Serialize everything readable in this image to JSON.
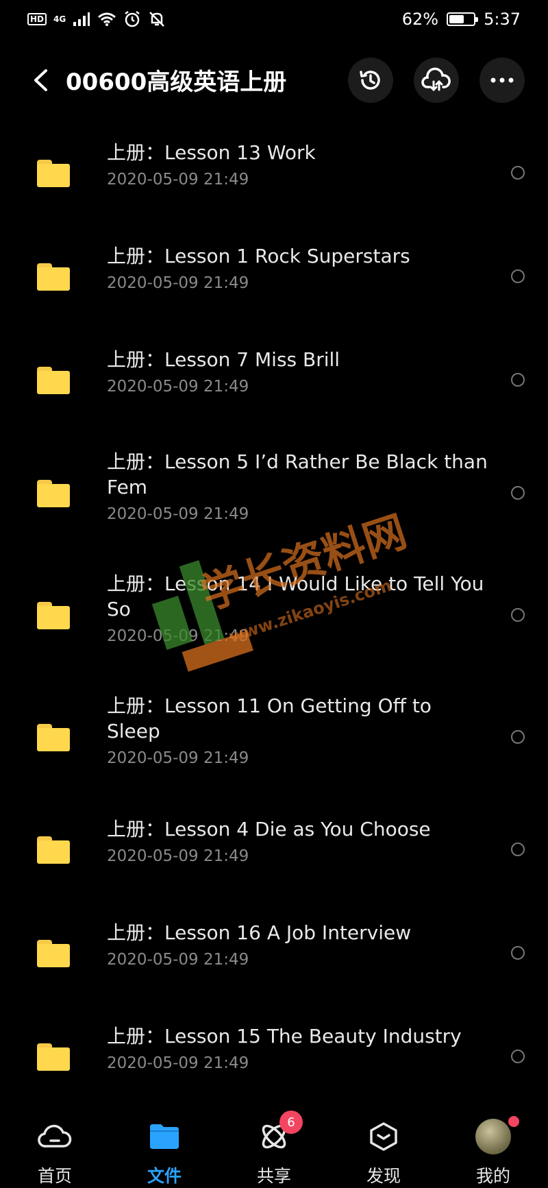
{
  "status": {
    "hd": "HD",
    "network": "4G",
    "battery_percent": "62%",
    "battery_level": 0.62,
    "time": "5:37"
  },
  "header": {
    "title": "00600高级英语上册",
    "icons": [
      "back-icon",
      "history-icon",
      "cloud-transfer-icon",
      "more-icon"
    ]
  },
  "files": [
    {
      "name": "上册：Lesson 13 Work",
      "date": "2020-05-09  21:49"
    },
    {
      "name": "上册：Lesson 1 Rock Superstars",
      "date": "2020-05-09  21:49"
    },
    {
      "name": "上册：Lesson 7  Miss Brill",
      "date": "2020-05-09  21:49"
    },
    {
      "name": "上册：Lesson 5 I’d Rather Be Black than Fem",
      "date": "2020-05-09  21:49"
    },
    {
      "name": "上册：Lesson 14 I Would Like to Tell You So",
      "date": "2020-05-09  21:49"
    },
    {
      "name": "上册：Lesson 11 On Getting Off to Sleep",
      "date": "2020-05-09  21:49"
    },
    {
      "name": "上册：Lesson 4 Die as You Choose",
      "date": "2020-05-09  21:49"
    },
    {
      "name": "上册：Lesson 16 A Job Interview",
      "date": "2020-05-09  21:49"
    },
    {
      "name": "上册：Lesson 15 The Beauty Industry",
      "date": "2020-05-09  21:49"
    }
  ],
  "watermark": {
    "text": "学长资料网",
    "url": "www.zikaoyis.com"
  },
  "nav": {
    "items": [
      {
        "label": "首页",
        "icon": "cloud-icon"
      },
      {
        "label": "文件",
        "icon": "folder-icon",
        "active": true
      },
      {
        "label": "共享",
        "icon": "share-atom-icon",
        "badge": "6"
      },
      {
        "label": "发现",
        "icon": "discover-box-icon"
      },
      {
        "label": "我的",
        "icon": "avatar"
      }
    ]
  },
  "colors": {
    "folder": "#ffd84d",
    "accent": "#2aa3ff",
    "badge": "#f24561",
    "watermark_orange": "#d9711f",
    "watermark_green": "#3b8a2e"
  }
}
